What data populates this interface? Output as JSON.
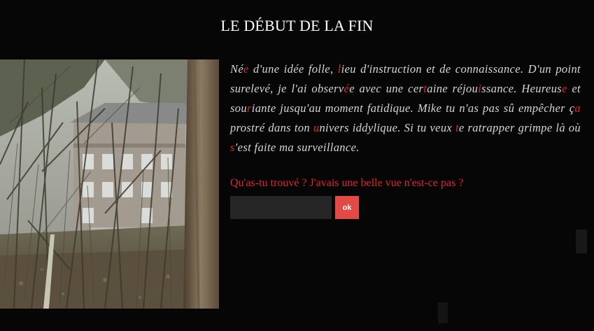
{
  "page": {
    "title": "LE DÉBUT DE LA FIN"
  },
  "photo": {
    "alt": "forest with building"
  },
  "poem": {
    "segments": [
      {
        "t": "N",
        "r": false
      },
      {
        "t": "é",
        "r": false
      },
      {
        "t": "e",
        "r": true
      },
      {
        "t": " d'une idée folle, ",
        "r": false
      },
      {
        "t": "l",
        "r": true
      },
      {
        "t": "ieu d'instruction et de connaissance. D'un point surelevé, je l'ai observ",
        "r": false
      },
      {
        "t": "é",
        "r": true
      },
      {
        "t": "e avec une cer",
        "r": false
      },
      {
        "t": "t",
        "r": true
      },
      {
        "t": "aine réjou",
        "r": false
      },
      {
        "t": "i",
        "r": true
      },
      {
        "t": "ssance. Heureus",
        "r": false
      },
      {
        "t": "e",
        "r": true
      },
      {
        "t": " et sou",
        "r": false
      },
      {
        "t": "r",
        "r": true
      },
      {
        "t": "iante jusqu'au moment fatidique. Mike tu n'as pas sû empêcher ç",
        "r": false
      },
      {
        "t": "a",
        "r": true
      },
      {
        "t": " prostré dans ton ",
        "r": false
      },
      {
        "t": "u",
        "r": true
      },
      {
        "t": "nivers iddylique. Si tu veux ",
        "r": false
      },
      {
        "t": "t",
        "r": true
      },
      {
        "t": "e ratrapper grimpe là où ",
        "r": false
      },
      {
        "t": "s",
        "r": true
      },
      {
        "t": "'est faite ma surveillance.",
        "r": false
      }
    ]
  },
  "form": {
    "question": "Qu'as-tu trouvé ? J'avais une belle vue n'est-ce pas ?",
    "input_value": "",
    "input_placeholder": "",
    "submit_label": "ok"
  },
  "colors": {
    "accent": "#e0262b",
    "button": "#e34a45",
    "background": "#060606",
    "text": "#d6d6d6"
  }
}
